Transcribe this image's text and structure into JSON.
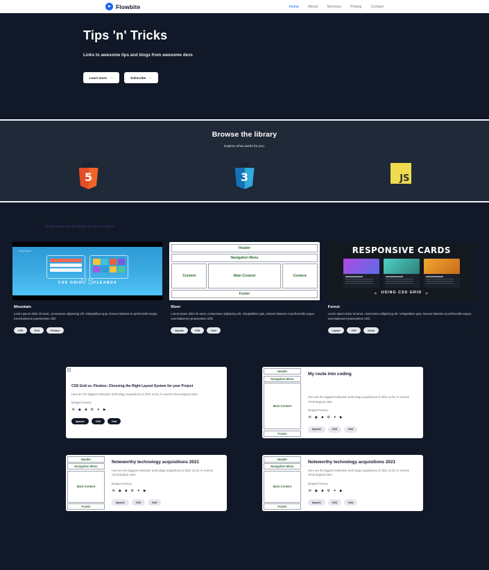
{
  "navbar": {
    "brand": "Flowbite",
    "logo_icon": "play-circle-icon",
    "links": [
      {
        "label": "Home",
        "active": true
      },
      {
        "label": "About",
        "active": false
      },
      {
        "label": "Services",
        "active": false
      },
      {
        "label": "Pricing",
        "active": false
      },
      {
        "label": "Contact",
        "active": false
      }
    ]
  },
  "hero": {
    "title": "Tips 'n' Tricks",
    "subtitle": "Links to awesome tips and blogs from awesome devs",
    "primary_button": "Learn more",
    "secondary_button": "Subscribe",
    "arrow": "→"
  },
  "library": {
    "title": "Browse the library",
    "subtitle": "Explore what works for you.",
    "logos": [
      {
        "name": "html5-logo",
        "caption": "HTML",
        "numeral": "5"
      },
      {
        "name": "css3-logo",
        "caption": "CSS",
        "numeral": "3"
      },
      {
        "name": "javascript-logo",
        "caption": "",
        "numeral": "JS"
      }
    ]
  },
  "blogs": {
    "heading": "Read some great blogs on great topics",
    "cards": [
      {
        "title": "Mountain",
        "text": "Lorem ipsum dolor sit amet, consectetur adipiscing elit. Voluptatibus quia, Nonea! Maiores et perferendis eaque, exercitationem praesentium nihil.",
        "tags": [
          "CSS",
          "Grid",
          "Flexbox"
        ],
        "image": {
          "kind": "css-grid-vs-flexbox",
          "brand": "simplilearn",
          "vs": "VS",
          "left_label": "CSS GRID",
          "right_label": "FLEXBOX"
        }
      },
      {
        "title": "River",
        "text": "Lorem ipsum dolor sit amet, consectetur adipiscing elit. Voluptatibus quia, Nonea! Maiores et perferendis eaque, exercitationem praesentium nihil.",
        "tags": [
          "layouts",
          "CSS",
          "Grid"
        ],
        "image": {
          "kind": "wireframe",
          "header": "Header",
          "nav": "Navigation Menu",
          "left": "Content",
          "main": "Main Content",
          "right": "Content",
          "footer": "Footer"
        }
      },
      {
        "title": "Forest",
        "text": "Lorem ipsum dolor sit amet, consectetur adipiscing elit. Voluptatibus quia, Nonea! Maiores et perferendis eaque, exercitationem praesentium nihil.",
        "tags": [
          "Layout",
          "CSS",
          "Cards"
        ],
        "image": {
          "kind": "responsive-cards",
          "title": "RESPONSIVE CARDS",
          "footer": "USING CSS GRID"
        }
      }
    ]
  },
  "lower": {
    "rows": [
      [
        {
          "layout": "vertical",
          "image": "broken-image",
          "title": "CSS Grid vs. Flexbox: Choosing the Right Layout System for your Project",
          "text": "Here are the biggest enterprise technology acquisitions of 2021 so far, in reverse chronological order.",
          "author": "Morgan Feeney",
          "tags": [
            "layouts",
            "CSS",
            "Grid"
          ],
          "tag_style": "dark"
        },
        {
          "layout": "horizontal",
          "image": "wireframe",
          "title": "My route into coding",
          "text": "Here are the biggest enterprise technology acquisitions of 2021 so far, in reverse chronological order.",
          "author": "Morgan Feeney",
          "tags": [
            "layouts",
            "CSS",
            "Grid"
          ],
          "tag_style": "light"
        }
      ],
      [
        {
          "layout": "horizontal",
          "image": "wireframe",
          "title": "Noteworthy technology acquisitions 2021",
          "text": "Here are the biggest enterprise technology acquisitions of 2021 so far, in reverse chronological order.",
          "author": "Morgan Feeney",
          "tags": [
            "layouts",
            "CSS",
            "Grid"
          ],
          "tag_style": "light"
        },
        {
          "layout": "horizontal",
          "image": "wireframe",
          "title": "Noteworthy technology acquisitions 2021",
          "text": "Here are the biggest enterprise technology acquisitions of 2021 so far, in reverse chronological order.",
          "author": "Morgan Feeney",
          "tags": [
            "layouts",
            "CSS",
            "Grid"
          ],
          "tag_style": "light"
        }
      ]
    ],
    "wireframe_labels": {
      "header": "Header",
      "nav": "Navigation Menu",
      "main": "Main Content",
      "footer": "Footer"
    },
    "social_icons": [
      "email-icon",
      "github-icon",
      "linkedin-icon",
      "instagram-icon",
      "twitter-icon",
      "youtube-icon"
    ]
  },
  "colors": {
    "page_bg": "#111827",
    "section_bg": "#1f2937",
    "accent": "#1c64f2",
    "html5": "#e44d26",
    "css3": "#1572b6",
    "js": "#f0db4f"
  }
}
